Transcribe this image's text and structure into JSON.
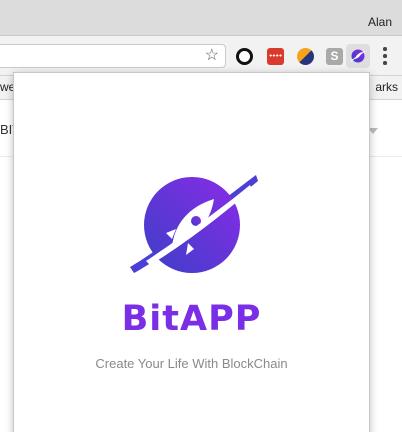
{
  "titlebar": {
    "user_name": "Alan"
  },
  "toolbar": {
    "bookmark_icon": "star-icon",
    "extensions": [
      {
        "name": "ring-extension-icon"
      },
      {
        "name": "password-extension-icon"
      },
      {
        "name": "half-circle-extension-icon"
      },
      {
        "name": "s-extension-icon",
        "label": "S"
      },
      {
        "name": "bitapp-extension-icon"
      }
    ],
    "menu_icon": "more-vert-icon"
  },
  "bookmarks_bar": {
    "left_text": "wes",
    "right_text": "arks"
  },
  "page": {
    "partial_text": "BIT"
  },
  "popup": {
    "brand": "BitAPP",
    "tagline": "Create Your Life With BlockChain",
    "colors": {
      "brand": "#7a2fe6",
      "logo_start": "#3c3fc7",
      "logo_end": "#8a2be8"
    }
  }
}
